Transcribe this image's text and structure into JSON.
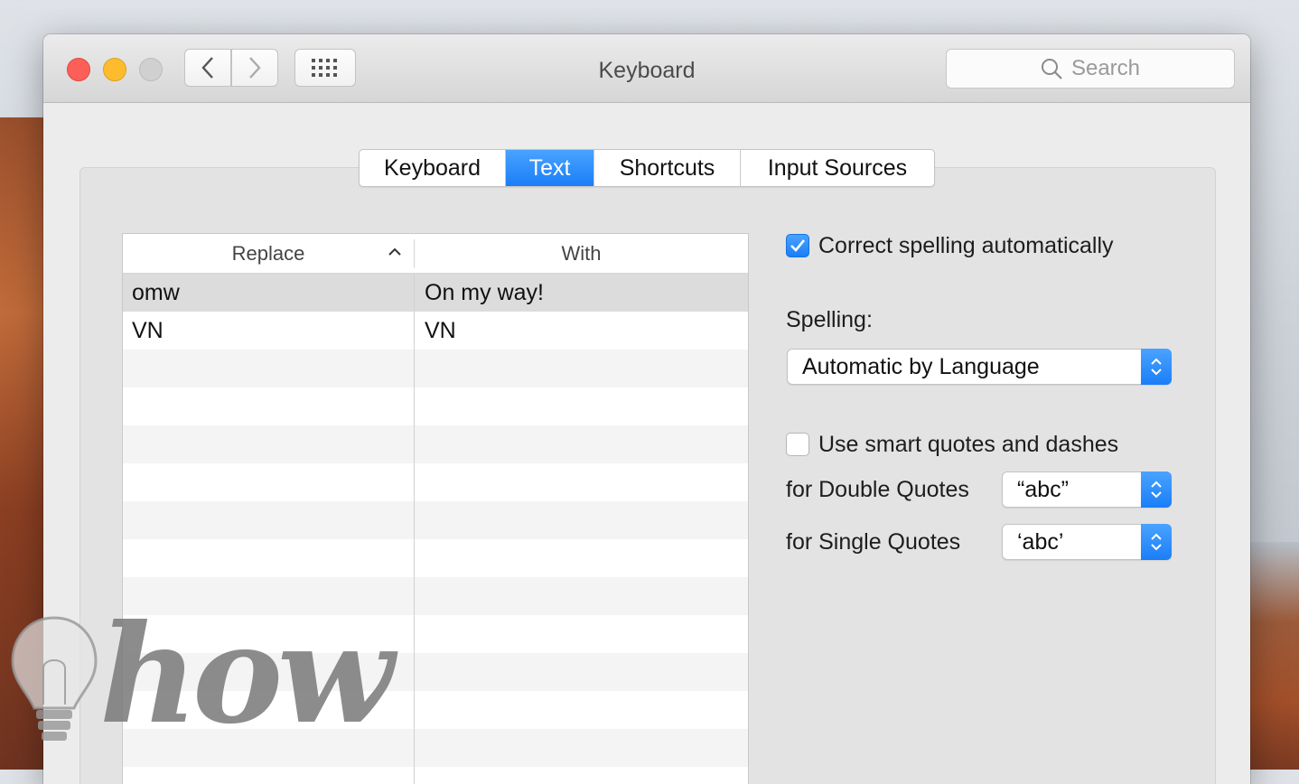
{
  "window": {
    "title": "Keyboard"
  },
  "search": {
    "placeholder": "Search"
  },
  "tabs": [
    {
      "label": "Keyboard",
      "active": false
    },
    {
      "label": "Text",
      "active": true
    },
    {
      "label": "Shortcuts",
      "active": false
    },
    {
      "label": "Input Sources",
      "active": false
    }
  ],
  "table": {
    "columns": [
      "Replace",
      "With"
    ],
    "rows": [
      {
        "replace": "omw",
        "with": "On my way!"
      },
      {
        "replace": "VN",
        "with": "VN"
      }
    ]
  },
  "options": {
    "correct_spelling": {
      "label": "Correct spelling automatically",
      "checked": true
    },
    "spelling_label": "Spelling:",
    "spelling_value": "Automatic by Language",
    "smart_quotes": {
      "label": "Use smart quotes and dashes",
      "checked": false
    },
    "double_quotes_label": "for Double Quotes",
    "double_quotes_value": "“abc”",
    "single_quotes_label": "for Single Quotes",
    "single_quotes_value": "‘abc’"
  },
  "watermark": {
    "text": "how"
  },
  "colors": {
    "accent": "#1a7ef7",
    "red": "#fc5f57",
    "yellow": "#fdbc2e"
  }
}
